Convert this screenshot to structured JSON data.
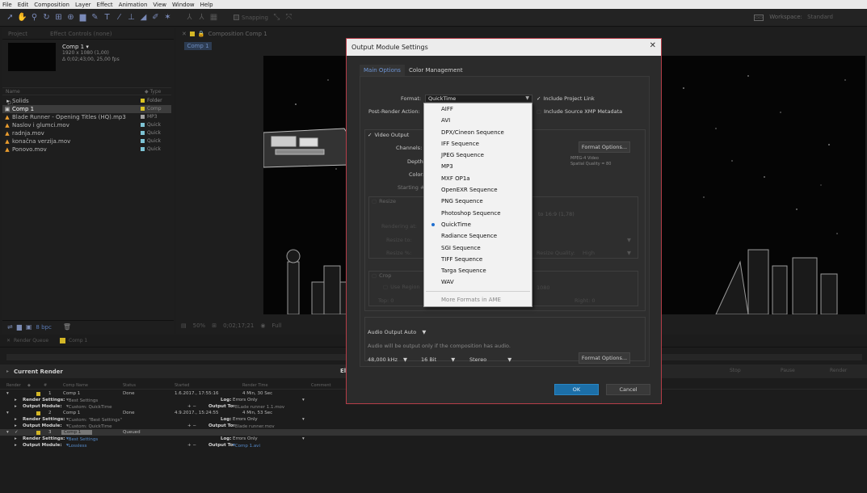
{
  "menu": [
    "File",
    "Edit",
    "Composition",
    "Layer",
    "Effect",
    "Animation",
    "View",
    "Window",
    "Help"
  ],
  "toolbar": {
    "snapping_label": "Snapping",
    "workspace_label": "Workspace:",
    "workspace_value": "Standard"
  },
  "project": {
    "tab_project": "Project",
    "tab_effect_controls": "Effect Controls (none)",
    "comp_name": "Comp 1 ▾",
    "comp_res": "1920 x 1080 (1,00)",
    "comp_dur": "Δ 0;02;43;00, 25,00 fps",
    "search_glyph": "ρ.",
    "col_name": "Name",
    "col_type": "Type",
    "items": [
      {
        "icon": "▸ ▆",
        "name": "Solids",
        "type": "Folder",
        "color": "#d9c324"
      },
      {
        "icon": "▣",
        "name": "Comp 1",
        "type": "Comp",
        "color": "#d9c324"
      },
      {
        "icon": "▲",
        "name": "Blade Runner - Opening Titles (HQ).mp3",
        "type": "MP3",
        "color": "#a0a0a0"
      },
      {
        "icon": "▲",
        "name": "Naslov i glumci.mov",
        "type": "Quick",
        "color": "#7ec3d4"
      },
      {
        "icon": "▲",
        "name": "radnja.mov",
        "type": "Quick",
        "color": "#7ec3d4"
      },
      {
        "icon": "▲",
        "name": "konačna verzija.mov",
        "type": "Quick",
        "color": "#7ec3d4"
      },
      {
        "icon": "▲",
        "name": "Ponovo.mov",
        "type": "Quick",
        "color": "#7ec3d4"
      }
    ],
    "bpc": "8 bpc"
  },
  "comp": {
    "tab_label": "Composition Comp 1",
    "sub_tab": "Comp 1",
    "zoom": "50%",
    "timecode": "0;02;17;21",
    "resolution": "Full"
  },
  "render_queue": {
    "tab_render_queue": "Render Queue",
    "tab_comp": "Comp 1",
    "current_render": "Current Render",
    "elapsed": "El",
    "stop": "Stop",
    "pause": "Pause",
    "render": "Render",
    "headers": {
      "render": "Render",
      "num": "#",
      "comp_name": "Comp Name",
      "status": "Status",
      "started": "Started",
      "render_time": "Render Time",
      "comment": "Comment"
    },
    "row1": {
      "num": "1",
      "name": "Comp 1",
      "status": "Done",
      "started": "1.6.2017., 17:55:16",
      "time": "4 Min, 30 Sec",
      "rs_label": "Render Settings:",
      "rs_value": "Best Settings",
      "log_label": "Log:",
      "log_value": "Errors Only",
      "om_label": "Output Module:",
      "om_value": "Custom: QuickTime",
      "out_label": "Output To:",
      "out_value": "BLade runner 1.1.mov"
    },
    "row2": {
      "num": "2",
      "name": "Comp 1",
      "status": "Done",
      "started": "4.9.2017., 15:24:55",
      "time": "4 Min, 53 Sec",
      "rs_label": "Render Settings:",
      "rs_value": "Custom: \"Best Settings\"",
      "log_label": "Log:",
      "log_value": "Errors Only",
      "om_label": "Output Module:",
      "om_value": "Custom: QuickTime",
      "out_label": "Output To:",
      "out_value": "Blade runner.mov"
    },
    "row3": {
      "num": "3",
      "name": "Comp 1",
      "status": "Queued",
      "rs_label": "Render Settings:",
      "rs_value": "Best Settings",
      "log_label": "Log:",
      "log_value": "Errors Only",
      "om_label": "Output Module:",
      "om_value": "Lossless",
      "out_label": "Output To:",
      "out_value": "Comp 1.avi"
    }
  },
  "dialog": {
    "title": "Output Module Settings",
    "tab_main": "Main Options",
    "tab_color": "Color Management",
    "format_label": "Format:",
    "format_value": "QuickTime",
    "post_render_label": "Post-Render Action:",
    "include_project_link": "Include Project Link",
    "include_xmp": "Include Source XMP Metadata",
    "video_output": "Video Output",
    "channels_label": "Channels:",
    "depth_label": "Depth:",
    "color_label": "Color:",
    "starting_label": "Starting #:",
    "format_options": "Format Options...",
    "codec_line1": "MPEG-4 Video",
    "codec_line2": "Spatial Quality = 80",
    "resize": "Resize",
    "aspect_text": "to 16:9 (1,78)",
    "rendering_at": "Rendering at:",
    "resize_to": "Resize to:",
    "resize_pct": "Resize %:",
    "resize_quality_label": "Resize Quality:",
    "resize_quality_value": "High",
    "crop": "Crop",
    "use_region": "Use Region",
    "crop_dims": "1080",
    "top_label": "Top: 0",
    "right_label": "Right: 0",
    "audio_output": "Audio Output Auto",
    "audio_note": "Audio will be output only if the composition has audio.",
    "sample_rate": "48,000 kHz",
    "bit_depth": "16 Bit",
    "channels_audio": "Stereo",
    "audio_format_options": "Format Options...",
    "ok": "OK",
    "cancel": "Cancel",
    "close_glyph": "✕"
  },
  "format_dropdown": {
    "items": [
      "AIFF",
      "AVI",
      "DPX/Cineon Sequence",
      "IFF Sequence",
      "JPEG Sequence",
      "MP3",
      "MXF OP1a",
      "OpenEXR Sequence",
      "PNG Sequence",
      "Photoshop Sequence",
      "QuickTime",
      "Radiance Sequence",
      "SGI Sequence",
      "TIFF Sequence",
      "Targa Sequence",
      "WAV"
    ],
    "selected": "QuickTime",
    "more": "More Formats in AME"
  }
}
